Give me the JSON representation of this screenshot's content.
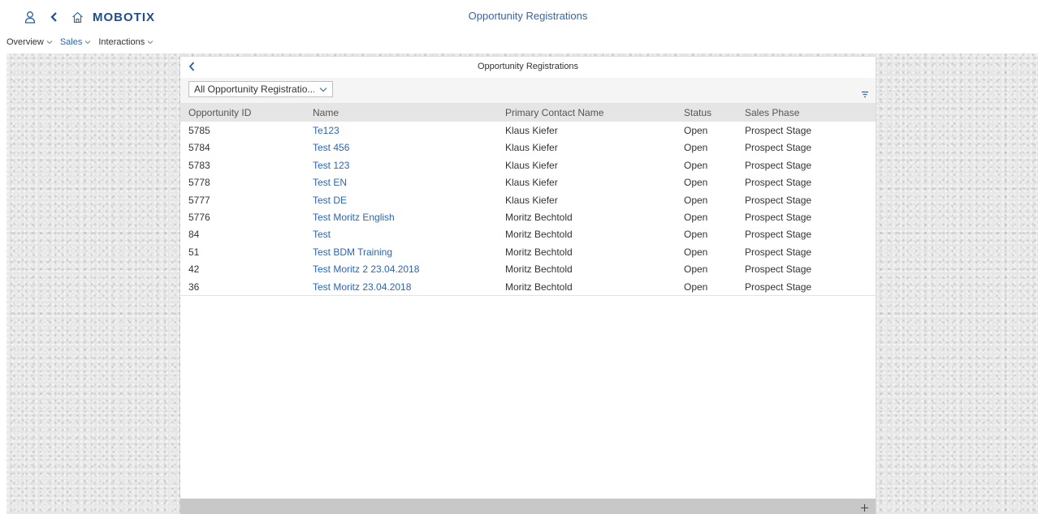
{
  "shell": {
    "brand": "MOBOTIX",
    "title": "Opportunity Registrations",
    "icons": [
      "user-icon",
      "back-icon",
      "home-icon"
    ]
  },
  "nav": {
    "items": [
      {
        "label": "Overview",
        "active": false
      },
      {
        "label": "Sales",
        "active": true
      },
      {
        "label": "Interactions",
        "active": false
      }
    ]
  },
  "panel": {
    "title": "Opportunity Registrations",
    "filter_select": {
      "value": "All Opportunity Registratio..."
    },
    "columns": [
      "Opportunity ID",
      "Name",
      "Primary Contact Name",
      "Status",
      "Sales Phase"
    ],
    "rows": [
      {
        "id": "5785",
        "name": "Te123",
        "contact": "Klaus Kiefer",
        "status": "Open",
        "phase": "Prospect Stage"
      },
      {
        "id": "5784",
        "name": "Test 456",
        "contact": "Klaus Kiefer",
        "status": "Open",
        "phase": "Prospect Stage"
      },
      {
        "id": "5783",
        "name": "Test 123",
        "contact": "Klaus Kiefer",
        "status": "Open",
        "phase": "Prospect Stage"
      },
      {
        "id": "5778",
        "name": "Test EN",
        "contact": "Klaus Kiefer",
        "status": "Open",
        "phase": "Prospect Stage"
      },
      {
        "id": "5777",
        "name": "Test DE",
        "contact": "Klaus Kiefer",
        "status": "Open",
        "phase": "Prospect Stage"
      },
      {
        "id": "5776",
        "name": "Test Moritz English",
        "contact": "Moritz Bechtold",
        "status": "Open",
        "phase": "Prospect Stage"
      },
      {
        "id": "84",
        "name": "Test",
        "contact": "Moritz Bechtold",
        "status": "Open",
        "phase": "Prospect Stage"
      },
      {
        "id": "51",
        "name": "Test BDM Training",
        "contact": "Moritz Bechtold",
        "status": "Open",
        "phase": "Prospect Stage"
      },
      {
        "id": "42",
        "name": "Test Moritz 2 23.04.2018",
        "contact": "Moritz Bechtold",
        "status": "Open",
        "phase": "Prospect Stage"
      },
      {
        "id": "36",
        "name": "Test Moritz 23.04.2018",
        "contact": "Moritz Bechtold",
        "status": "Open",
        "phase": "Prospect Stage"
      }
    ]
  },
  "colors": {
    "brand_blue": "#1f4e8c",
    "link_blue": "#2a66b6",
    "header_bg": "#e5e5e5",
    "footer_bg": "#c8c8c8"
  }
}
